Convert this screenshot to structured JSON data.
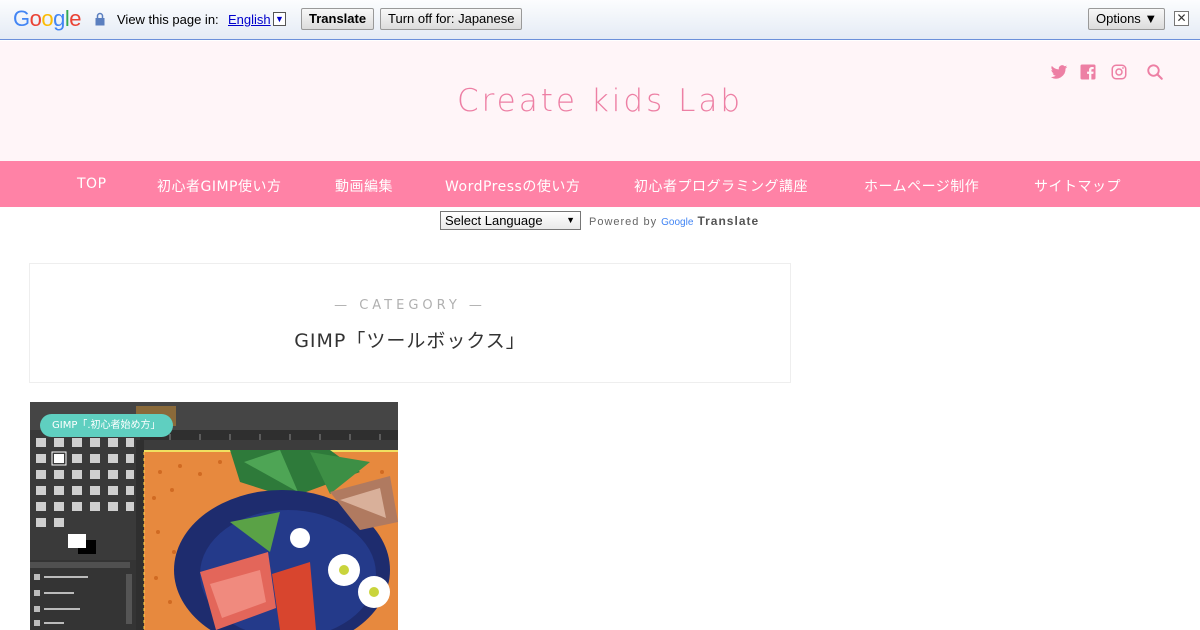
{
  "translate_bar": {
    "logo": "Google",
    "view_in": "View this page in:",
    "language": "English",
    "language_arrow": "▼",
    "translate_button": "Translate",
    "turn_off_button": "Turn off for: Japanese",
    "options_button": "Options ▼",
    "close": "✕"
  },
  "header": {
    "site_title": "Create kids Lab",
    "icons": [
      "twitter-icon",
      "facebook-icon",
      "instagram-icon",
      "search-icon"
    ],
    "accent_color": "#ed7fa4"
  },
  "nav": {
    "items": [
      {
        "label": "TOP"
      },
      {
        "label": "初心者GIMP使い方"
      },
      {
        "label": "動画編集"
      },
      {
        "label": "WordPressの使い方"
      },
      {
        "label": "初心者プログラミング講座"
      },
      {
        "label": "ホームページ制作"
      },
      {
        "label": "サイトマップ"
      }
    ],
    "background": "#ff82a6"
  },
  "language_widget": {
    "select_value": "Select Language",
    "powered_by": "Powered by",
    "google": "Google",
    "translate": "Translate"
  },
  "category": {
    "label": "— CATEGORY —",
    "title": "GIMP「ツールボックス」"
  },
  "card": {
    "tag": "GIMP「.初心者始め方」"
  }
}
